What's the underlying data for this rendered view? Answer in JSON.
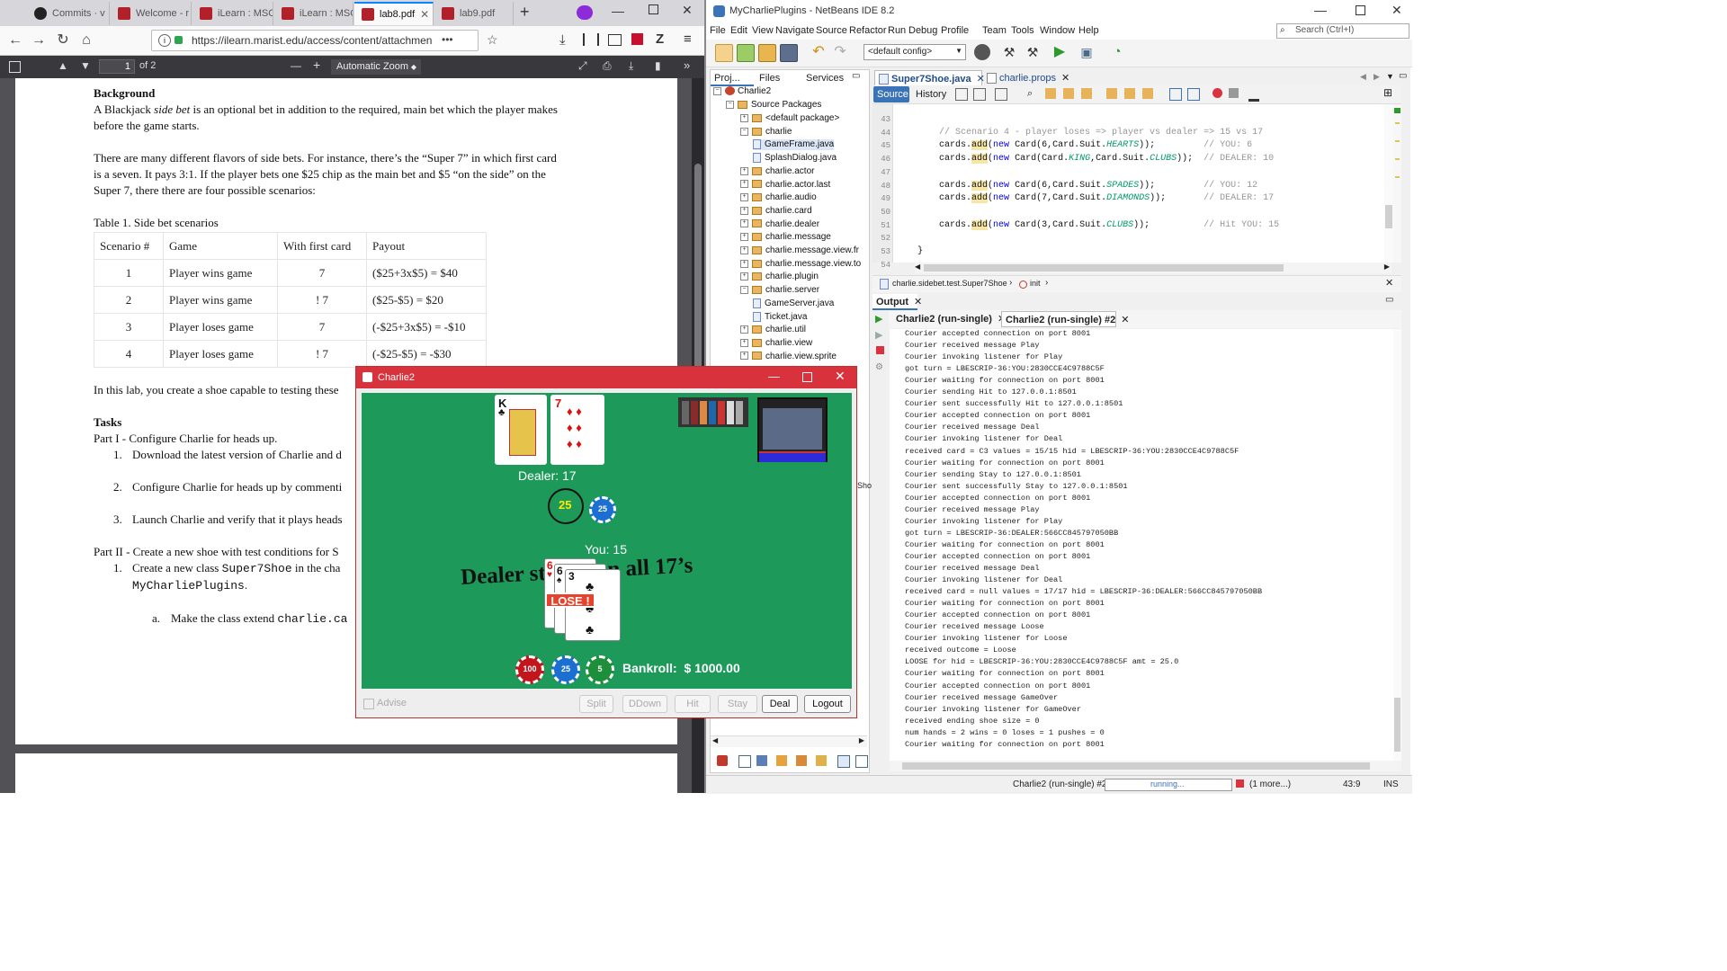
{
  "firefox": {
    "tabs": [
      {
        "label": "Commits · v",
        "color": "#222"
      },
      {
        "label": "Welcome - r",
        "color": "#b2202a"
      },
      {
        "label": "iLearn : MSC",
        "color": "#b2202a"
      },
      {
        "label": "iLearn : MSC",
        "color": "#b2202a"
      },
      {
        "label": "lab8.pdf",
        "color": "#b2202a"
      },
      {
        "label": "lab9.pdf",
        "color": "#b2202a"
      }
    ],
    "new_tab": "+",
    "url": "https://ilearn.marist.edu/access/content/attachmen",
    "url_menu": "•••",
    "pdf_page": "1",
    "pdf_page_total": "of 2",
    "zoom": "Automatic Zoom"
  },
  "doc": {
    "heading_background": "Background",
    "p1a": "A Blackjack ",
    "p1_em": "side bet",
    "p1b": " is an optional bet in addition to the required, main bet which the player makes",
    "p1c": "before the game starts.",
    "p2a": "There are many different flavors of side bets. For instance, there’s the “Super 7” in which first card",
    "p2b": "is a seven. It pays 3:1. If the player bets one $25 chip as the main bet and $5 “on the side” on the",
    "p2c": "Super 7, there there are four possible scenarios:",
    "table_caption": "Table 1. Side bet scenarios",
    "table_headers": [
      "Scenario #",
      "Game",
      "With first card",
      "Payout"
    ],
    "table_rows": [
      [
        "1",
        "Player wins game",
        "7",
        "($25+3x$5) = $40"
      ],
      [
        "2",
        "Player wins game",
        "! 7",
        "($25-$5) = $20"
      ],
      [
        "3",
        "Player loses game",
        "7",
        "(-$25+3x$5) = -$10"
      ],
      [
        "4",
        "Player loses game",
        "! 7",
        "(-$25-$5) = -$30"
      ]
    ],
    "p3": "In this lab, you create a shoe capable to testing these",
    "heading_tasks": "Tasks",
    "part1": "Part I - Configure Charlie for heads up.",
    "t1_num": "1.",
    "t1": "Download the latest version of Charlie and d",
    "t2_num": "2.",
    "t2": "Configure Charlie for heads up by commenti",
    "t3_num": "3.",
    "t3": "Launch Charlie and verify that it plays heads",
    "part2": "Part II - Create a new shoe with test conditions for S",
    "t4_num": "1.",
    "t4a": "Create a new class ",
    "t4_code": "Super7Shoe",
    "t4b": " in the cha",
    "t4_code2": "MyCharliePlugins",
    "t4c": ".",
    "ta_num": "a.",
    "ta": "Make the class extend ",
    "ta_code": "charlie.ca"
  },
  "game": {
    "title": "Charlie2",
    "dealer_label": "Dealer: 17",
    "you_label": "You: 15",
    "banner": "Dealer stands on all 17’s",
    "lose_badge": "LOSE !",
    "bet_amount": "25",
    "bet_chip": "25",
    "chips": [
      "100",
      "25",
      "5"
    ],
    "bankroll": "Bankroll:  $ 1000.00",
    "advise": "Advise",
    "buttons": {
      "split": "Split",
      "ddown": "DDown",
      "hit": "Hit",
      "stay": "Stay",
      "deal": "Deal",
      "logout": "Logout"
    },
    "dealer_cards": [
      "K",
      "7"
    ],
    "player_cards": [
      "6",
      "6",
      "3"
    ]
  },
  "netbeans": {
    "title": "MyCharliePlugins - NetBeans IDE 8.2",
    "menu": [
      "File",
      "Edit",
      "View",
      "Navigate",
      "Source",
      "Refactor",
      "Run",
      "Debug",
      "Profile",
      "Team",
      "Tools",
      "Window",
      "Help"
    ],
    "search_placeholder": "Search (Ctrl+I)",
    "config": "<default config>",
    "panel_tabs": [
      "Proj...",
      "Files",
      "Services"
    ],
    "tree": {
      "root": "Charlie2",
      "source_packages": "Source Packages",
      "items": [
        {
          "label": "<default package>",
          "type": "pkg",
          "indent": 2
        },
        {
          "label": "charlie",
          "type": "pkg",
          "indent": 2,
          "open": true
        },
        {
          "label": "GameFrame.java",
          "type": "file",
          "indent": 3,
          "selected": true
        },
        {
          "label": "SplashDialog.java",
          "type": "file",
          "indent": 3
        },
        {
          "label": "charlie.actor",
          "type": "pkg",
          "indent": 2
        },
        {
          "label": "charlie.actor.last",
          "type": "pkg",
          "indent": 2
        },
        {
          "label": "charlie.audio",
          "type": "pkg",
          "indent": 2
        },
        {
          "label": "charlie.card",
          "type": "pkg",
          "indent": 2
        },
        {
          "label": "charlie.dealer",
          "type": "pkg",
          "indent": 2
        },
        {
          "label": "charlie.message",
          "type": "pkg",
          "indent": 2
        },
        {
          "label": "charlie.message.view.fr",
          "type": "pkg",
          "indent": 2
        },
        {
          "label": "charlie.message.view.to",
          "type": "pkg",
          "indent": 2
        },
        {
          "label": "charlie.plugin",
          "type": "pkg",
          "indent": 2
        },
        {
          "label": "charlie.server",
          "type": "pkg",
          "indent": 2,
          "open": true
        },
        {
          "label": "GameServer.java",
          "type": "file",
          "indent": 3
        },
        {
          "label": "Ticket.java",
          "type": "file",
          "indent": 3
        },
        {
          "label": "charlie.util",
          "type": "pkg",
          "indent": 2
        },
        {
          "label": "charlie.view",
          "type": "pkg",
          "indent": 2
        },
        {
          "label": "charlie.view.sprite",
          "type": "pkg",
          "indent": 2
        }
      ]
    },
    "editor_tabs": [
      "Super7Shoe.java",
      "charlie.props"
    ],
    "source_tab": "Source",
    "history_tab": "History",
    "code_lines": [
      {
        "n": "43",
        "t": ""
      },
      {
        "n": "44",
        "t": "        // Scenario 4 - player loses => player vs dealer => 15 vs 17"
      },
      {
        "n": "45",
        "t": "        cards.add(new Card(6,Card.Suit.HEARTS));         // YOU: 6"
      },
      {
        "n": "46",
        "t": "        cards.add(new Card(Card.KING,Card.Suit.CLUBS));  // DEALER: 10"
      },
      {
        "n": "47",
        "t": ""
      },
      {
        "n": "48",
        "t": "        cards.add(new Card(6,Card.Suit.SPADES));         // YOU: 12"
      },
      {
        "n": "49",
        "t": "        cards.add(new Card(7,Card.Suit.DIAMONDS));       // DEALER: 17"
      },
      {
        "n": "50",
        "t": ""
      },
      {
        "n": "51",
        "t": "        cards.add(new Card(3,Card.Suit.CLUBS));          // Hit YOU: 15"
      },
      {
        "n": "52",
        "t": ""
      },
      {
        "n": "53",
        "t": "    }"
      },
      {
        "n": "54",
        "t": ""
      }
    ],
    "breadcrumb": [
      "charlie.sidebet.test.Super7Shoe",
      "init"
    ],
    "output_title": "Output",
    "output_tabs": [
      "Charlie2 (run-single)",
      "Charlie2 (run-single) #2"
    ],
    "output_lines": [
      "Courier accepted connection on port 8001",
      "Courier received message Play",
      "Courier invoking listener for Play",
      "got turn = LBESCRIP-36:YOU:2830CCE4C9788C5F",
      "Courier waiting for connection on port 8001",
      "Courier sending Hit to 127.0.0.1:8501",
      "Courier sent successfully Hit to 127.0.0.1:8501",
      "Courier accepted connection on port 8001",
      "Courier received message Deal",
      "Courier invoking listener for Deal",
      "received card = C3 values = 15/15 hid = LBESCRIP-36:YOU:2830CCE4C9788C5F",
      "Courier waiting for connection on port 8001",
      "Courier sending Stay to 127.0.0.1:8501",
      "Courier sent successfully Stay to 127.0.0.1:8501",
      "Courier accepted connection on port 8001",
      "Courier received message Play",
      "Courier invoking listener for Play",
      "got turn = LBESCRIP-36:DEALER:566CC845797050BB",
      "Courier waiting for connection on port 8001",
      "Courier accepted connection on port 8001",
      "Courier received message Deal",
      "Courier invoking listener for Deal",
      "received card = null values = 17/17 hid = LBESCRIP-36:DEALER:566CC845797050BB",
      "Courier waiting for connection on port 8001",
      "Courier accepted connection on port 8001",
      "Courier received message Loose",
      "Courier invoking listener for Loose",
      "received outcome = Loose",
      "LOOSE for hid = LBESCRIP-36:YOU:2830CCE4C9788C5F amt = 25.0",
      "Courier waiting for connection on port 8001",
      "Courier accepted connection on port 8001",
      "Courier received message GameOver",
      "Courier invoking listener for GameOver",
      "received ending shoe size = 0",
      "num hands = 2 wins = 0 loses = 1 pushes = 0",
      "Courier waiting for connection on port 8001"
    ],
    "status_run": "Charlie2 (run-single) #2",
    "status_running": "running...",
    "status_more": "(1 more...)",
    "status_pos": "43:9",
    "status_ins": "INS",
    "peek_text": "Sho"
  }
}
